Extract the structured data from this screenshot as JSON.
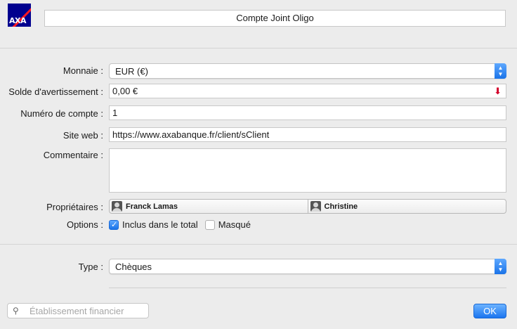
{
  "header": {
    "logo_text": "AXA",
    "account_name": "Compte Joint Oligo"
  },
  "form": {
    "currency": {
      "label": "Monnaie :",
      "value": "EUR (€)"
    },
    "warning_balance": {
      "label": "Solde d'avertissement :",
      "value": "0,00 €"
    },
    "account_number": {
      "label": "Numéro de compte :",
      "value": "1"
    },
    "website": {
      "label": "Site web :",
      "value": "https://www.axabanque.fr/client/sClient"
    },
    "comment": {
      "label": "Commentaire :",
      "value": ""
    },
    "owners": {
      "label": "Propriétaires :",
      "items": [
        "Franck Lamas",
        "Christine"
      ]
    },
    "options": {
      "label": "Options :",
      "included": "Inclus dans le total",
      "hidden": "Masqué"
    },
    "type": {
      "label": "Type :",
      "value": "Chèques"
    }
  },
  "footer": {
    "search_placeholder": "Établissement financier",
    "ok_label": "OK"
  },
  "colors": {
    "accent": "#1a73e8",
    "warning_arrow": "#d3002b",
    "axa_blue": "#00008f",
    "axa_red": "#ff1721"
  }
}
